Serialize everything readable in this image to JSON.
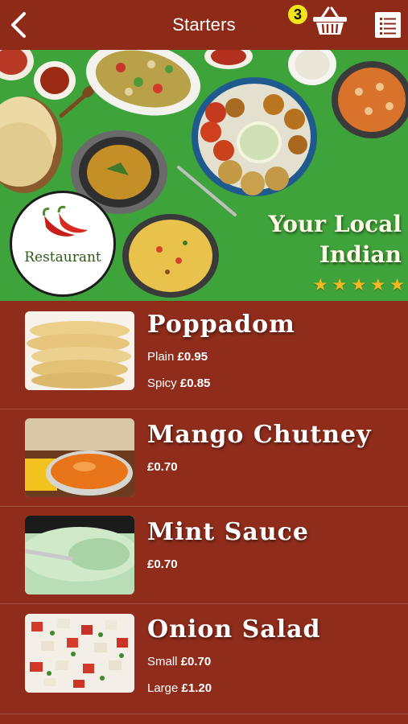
{
  "header": {
    "title": "Starters",
    "cart_count": "3"
  },
  "banner": {
    "logo_text": "Restaurant",
    "headline_line1": "Your Local",
    "headline_line2": "Indian",
    "rating": 5
  },
  "items": [
    {
      "name": "Poppadom",
      "prices": [
        {
          "label": "Plain",
          "value": "£0.95"
        },
        {
          "label": "Spicy",
          "value": "£0.85"
        }
      ]
    },
    {
      "name": "Mango Chutney",
      "prices": [
        {
          "label": "",
          "value": "£0.70"
        }
      ]
    },
    {
      "name": "Mint Sauce",
      "prices": [
        {
          "label": "",
          "value": "£0.70"
        }
      ]
    },
    {
      "name": "Onion Salad",
      "prices": [
        {
          "label": "Small",
          "value": "£0.70"
        },
        {
          "label": "Large",
          "value": "£1.20"
        }
      ]
    }
  ],
  "colors": {
    "background": "#8f2c1b",
    "banner_green": "#3fa33b",
    "badge_yellow": "#f2e41d",
    "star_gold": "#f7b722"
  },
  "icons": {
    "back": "chevron-left-icon",
    "basket": "shopping-basket-icon",
    "menu": "list-menu-icon",
    "star": "star-icon",
    "chilli": "chilli-pepper-icon"
  }
}
